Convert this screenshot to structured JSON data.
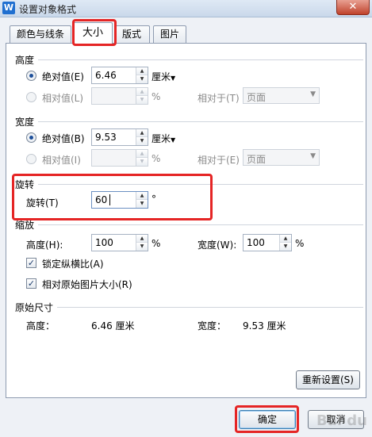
{
  "window": {
    "app_icon": "W",
    "title": "设置对象格式",
    "close_glyph": "✕"
  },
  "tabs": [
    {
      "label": "颜色与线条",
      "active": false
    },
    {
      "label": "大小",
      "active": true
    },
    {
      "label": "版式",
      "active": false
    },
    {
      "label": "图片",
      "active": false
    }
  ],
  "height_section": {
    "title": "高度",
    "absolute_label": "绝对值(E)",
    "absolute_value": "6.46",
    "absolute_unit": "厘米",
    "relative_label": "相对值(L)",
    "relative_unit": "%",
    "relative_to_label": "相对于(T)",
    "relative_to_value": "页面"
  },
  "width_section": {
    "title": "宽度",
    "absolute_label": "绝对值(B)",
    "absolute_value": "9.53",
    "absolute_unit": "厘米",
    "relative_label": "相对值(I)",
    "relative_unit": "%",
    "relative_to_label": "相对于(E)",
    "relative_to_value": "页面"
  },
  "rotation_section": {
    "title": "旋转",
    "label": "旋转(T)",
    "value": "60",
    "unit": "°"
  },
  "scale_section": {
    "title": "缩放",
    "height_label": "高度(H):",
    "height_value": "100",
    "height_unit": "%",
    "width_label": "宽度(W):",
    "width_value": "100",
    "width_unit": "%",
    "lock_aspect_label": "锁定纵横比(A)",
    "lock_aspect_checked": true,
    "relative_original_label": "相对原始图片大小(R)",
    "relative_original_checked": true
  },
  "original_size_section": {
    "title": "原始尺寸",
    "height_label": "高度：",
    "height_value": "6.46 厘米",
    "width_label": "宽度：",
    "width_value": "9.53 厘米"
  },
  "buttons": {
    "reset": "重新设置(S)",
    "ok": "确定",
    "cancel": "取消"
  },
  "watermark": "Bai  du",
  "accent": "#e52525"
}
